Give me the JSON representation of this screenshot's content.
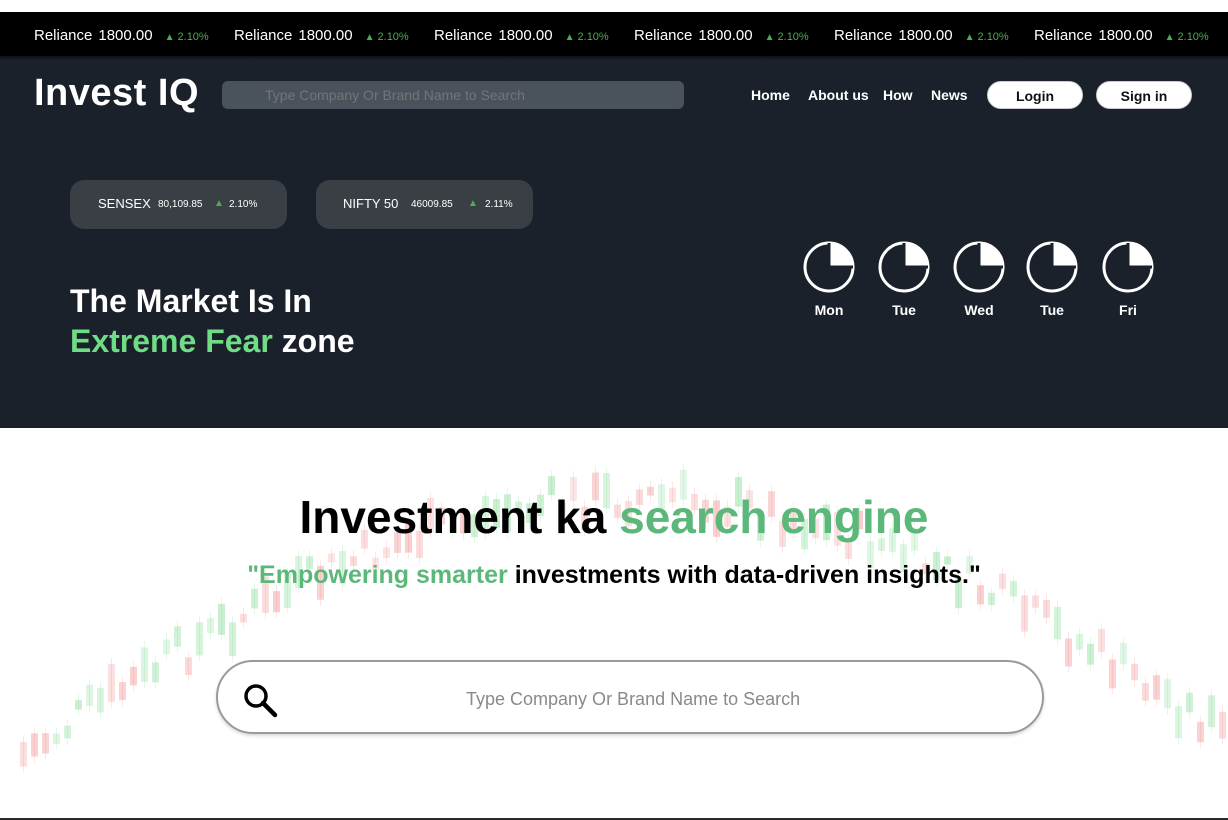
{
  "ticker": {
    "items": [
      {
        "name": "Reliance",
        "value": "1800.00",
        "change": "2.10%"
      },
      {
        "name": "Reliance",
        "value": "1800.00",
        "change": "2.10%"
      },
      {
        "name": "Reliance",
        "value": "1800.00",
        "change": "2.10%"
      },
      {
        "name": "Reliance",
        "value": "1800.00",
        "change": "2.10%"
      },
      {
        "name": "Reliance",
        "value": "1800.00",
        "change": "2.10%"
      },
      {
        "name": "Reliance",
        "value": "1800.00",
        "change": "2.10%"
      }
    ]
  },
  "header": {
    "logo": "Invest IQ",
    "search_placeholder": "Type Company Or Brand Name to Search",
    "nav": [
      "Home",
      "About us",
      "How",
      "News"
    ],
    "login_label": "Login",
    "signin_label": "Sign in"
  },
  "indices": [
    {
      "name": "SENSEX",
      "value": "80,109.85",
      "change": "2.10%"
    },
    {
      "name": "NIFTY 50",
      "value": "46009.85",
      "change": "2.11%"
    }
  ],
  "mood": {
    "line1": "The Market Is In",
    "highlight": "Extreme Fear",
    "suffix": " zone"
  },
  "week": [
    "Mon",
    "Tue",
    "Wed",
    "Tue",
    "Fri"
  ],
  "hero": {
    "headline_part1": "Investment ka ",
    "headline_part2": "search engine",
    "tagline_part1": "\"Empowering smarter",
    "tagline_part2": " investments with data-driven insights.\""
  },
  "main_search": {
    "placeholder": "Type Company Or Brand Name to Search"
  },
  "colors": {
    "accent_green": "#5cb87a",
    "fear_green": "#6fdc86",
    "dark_bg": "#1b212b",
    "up_green": "#4caf50"
  },
  "icons": {
    "day": "pie-chart-icon",
    "search": "search-icon"
  }
}
